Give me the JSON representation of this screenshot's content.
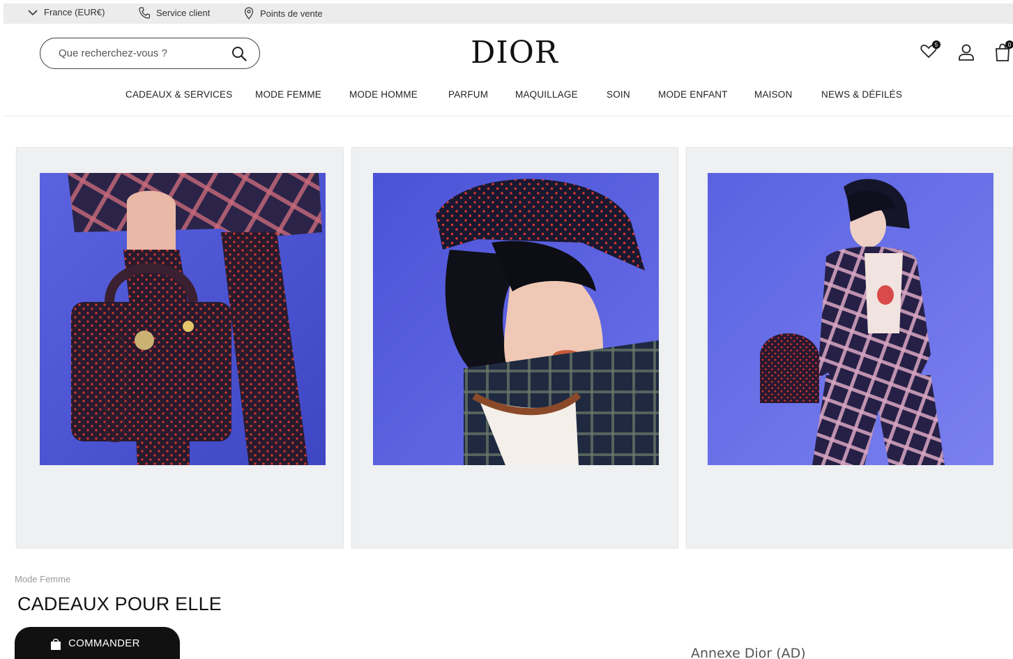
{
  "topbar": {
    "country": "France (EUR€)",
    "service": "Service client",
    "stores": "Points de vente"
  },
  "header": {
    "logo": "DIOR",
    "search_placeholder": "Que recherchez-vous ?",
    "wishlist_count": "5",
    "bag_count": "0"
  },
  "nav": {
    "items": [
      {
        "label": "CADEAUX & SERVICES"
      },
      {
        "label": "MODE FEMME"
      },
      {
        "label": "MODE HOMME"
      },
      {
        "label": "PARFUM"
      },
      {
        "label": "MAQUILLAGE"
      },
      {
        "label": "SOIN"
      },
      {
        "label": "MODE ENFANT"
      },
      {
        "label": "MAISON"
      },
      {
        "label": "NEWS & DÉFILÉS"
      }
    ]
  },
  "page": {
    "breadcrumb": "Mode Femme",
    "title": "CADEAUX POUR ELLE",
    "cta_label": "COMMANDER",
    "annex": "Annexe Dior (AD)"
  },
  "colors": {
    "backdrop_blue": "#4a55d8",
    "pattern_red": "#d8392e",
    "plaid_navy": "#1f1d3a",
    "card_bg": "#eef0f2"
  }
}
